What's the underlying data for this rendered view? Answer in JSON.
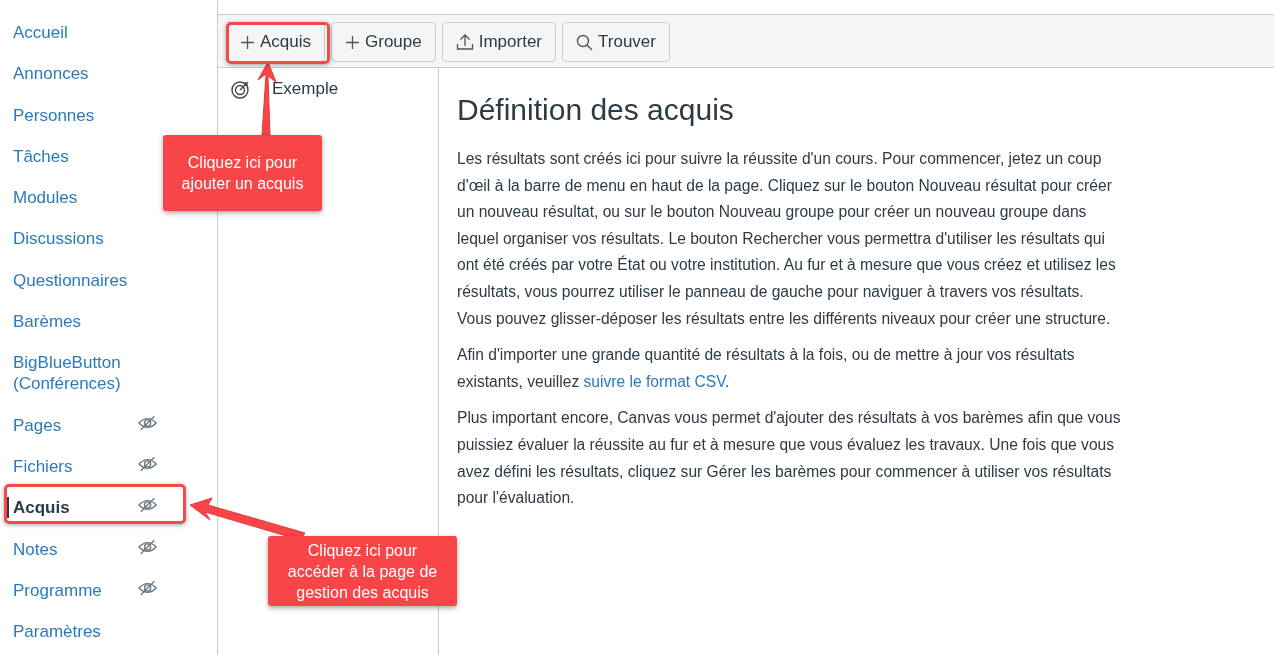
{
  "sidebar": {
    "items": [
      {
        "label": "Accueil",
        "hidden": false,
        "selected": false
      },
      {
        "label": "Annonces",
        "hidden": false,
        "selected": false
      },
      {
        "label": "Personnes",
        "hidden": false,
        "selected": false
      },
      {
        "label": "Tâches",
        "hidden": false,
        "selected": false
      },
      {
        "label": "Modules",
        "hidden": false,
        "selected": false
      },
      {
        "label": "Discussions",
        "hidden": false,
        "selected": false
      },
      {
        "label": "Questionnaires",
        "hidden": false,
        "selected": false
      },
      {
        "label": "Barèmes",
        "hidden": false,
        "selected": false
      },
      {
        "label": "BigBlueButton (Conférences)",
        "hidden": false,
        "selected": false
      },
      {
        "label": "Pages",
        "hidden": true,
        "selected": false
      },
      {
        "label": "Fichiers",
        "hidden": true,
        "selected": false
      },
      {
        "label": "Acquis",
        "hidden": true,
        "selected": true
      },
      {
        "label": "Notes",
        "hidden": true,
        "selected": false
      },
      {
        "label": "Programme",
        "hidden": true,
        "selected": false
      },
      {
        "label": "Paramètres",
        "hidden": false,
        "selected": false
      }
    ]
  },
  "toolbar": {
    "buttons": [
      {
        "label": "Acquis",
        "kind": "plus"
      },
      {
        "label": "Groupe",
        "kind": "plus"
      },
      {
        "label": "Importer",
        "kind": "upload"
      },
      {
        "label": "Trouver",
        "kind": "search"
      }
    ]
  },
  "tree": {
    "items": [
      {
        "label": "Exemple"
      }
    ]
  },
  "content": {
    "title": "Définition des acquis",
    "paragraphs": [
      {
        "text": "Les résultats sont créés ici pour suivre la réussite d'un cours. Pour commencer, jetez un coup d'œil à la barre de menu en haut de la page. Cliquez sur le bouton Nouveau résultat pour créer un nouveau résultat, ou sur le bouton Nouveau groupe pour créer un nouveau groupe dans lequel organiser vos résultats. Le bouton Rechercher vous permettra d'utiliser les résultats qui ont été créés par votre État ou votre institution. Au fur et à mesure que vous créez et utilisez les résultats, vous pourrez utiliser le panneau de gauche pour naviguer à travers vos résultats. Vous pouvez glisser-déposer les résultats entre les différents niveaux pour créer une structure."
      },
      {
        "text": "Afin d'importer une grande quantité de résultats à la fois, ou de mettre à jour vos résultats existants, veuillez ",
        "link": "suivre le format CSV",
        "after": "."
      },
      {
        "text": "Plus important encore, Canvas vous permet d'ajouter des résultats à vos barèmes afin que vous puissiez évaluer la réussite au fur et à mesure que vous évaluez les travaux. Une fois que vous avez défini les résultats, cliquez sur Gérer les barèmes pour commencer à utiliser vos résultats pour l'évaluation."
      }
    ]
  },
  "callouts": [
    {
      "text": "Cliquez ici pour ajouter un acquis",
      "kind": "up"
    },
    {
      "text": "Cliquez ici pour accéder à la page de gestion des acquis",
      "kind": "left"
    }
  ]
}
